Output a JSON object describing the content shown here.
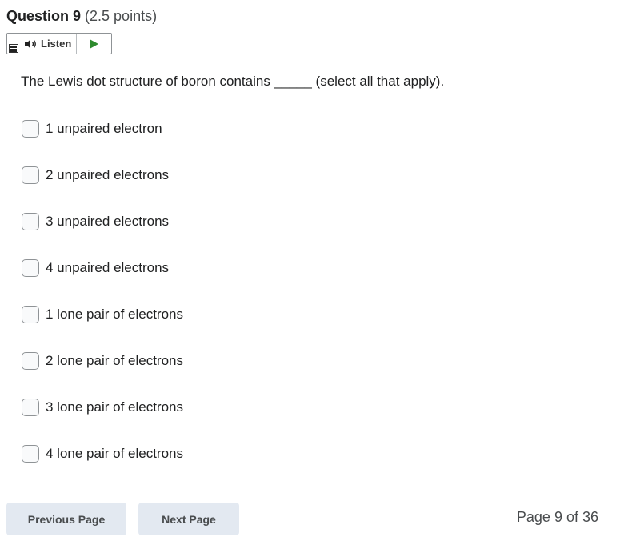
{
  "question": {
    "title": "Question 9",
    "points": "(2.5 points)",
    "text": "The Lewis dot structure of boron contains _____ (select all that apply)."
  },
  "listen": {
    "label": "Listen",
    "menu_icon": "menu-icon",
    "speaker_icon": "speaker-icon",
    "play_icon": "play-icon",
    "play_color": "#2e8b2e"
  },
  "options": [
    {
      "label": "1 unpaired electron",
      "checked": false
    },
    {
      "label": "2 unpaired electrons",
      "checked": false
    },
    {
      "label": "3 unpaired electrons",
      "checked": false
    },
    {
      "label": "4 unpaired electrons",
      "checked": false
    },
    {
      "label": "1 lone pair of electrons",
      "checked": false
    },
    {
      "label": "2 lone pair of electrons",
      "checked": false
    },
    {
      "label": "3 lone pair of electrons",
      "checked": false
    },
    {
      "label": "4 lone pair of electrons",
      "checked": false
    }
  ],
  "navigation": {
    "previous_label": "Previous Page",
    "next_label": "Next Page",
    "page_indicator": "Page 9 of 36",
    "button_color": "#e3e9f1"
  }
}
